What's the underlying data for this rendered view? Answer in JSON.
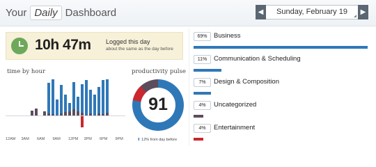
{
  "header": {
    "title_prefix": "Your",
    "period": "Daily",
    "title_suffix": "Dashboard",
    "date": "Sunday, February 19",
    "prev_icon": "triangle-left",
    "next_icon": "triangle-right"
  },
  "logged": {
    "icon": "clock-icon",
    "total": "10h 47m",
    "label": "Logged this day",
    "comparison": "about the same as the day before"
  },
  "hour_chart": {
    "label": "time by hour",
    "ticks": [
      "12AM",
      "3AM",
      "6AM",
      "9AM",
      "12PM",
      "3PM",
      "6PM",
      "9PM"
    ]
  },
  "pulse": {
    "label": "productivity pulse",
    "score": "91",
    "change": "12% from day before",
    "change_icon": "up-arrow"
  },
  "categories": [
    {
      "pct": "69%",
      "name": "Business",
      "value": 69,
      "color": "#2f78b8"
    },
    {
      "pct": "11%",
      "name": "Communication & Scheduling",
      "value": 11,
      "color": "#2f78b8"
    },
    {
      "pct": "7%",
      "name": "Design & Composition",
      "value": 7,
      "color": "#2f78b8"
    },
    {
      "pct": "4%",
      "name": "Uncategorized",
      "value": 4,
      "color": "#5c4d5e"
    },
    {
      "pct": "4%",
      "name": "Entertainment",
      "value": 4,
      "color": "#c8282e"
    }
  ],
  "colors": {
    "very_productive": "#2f78b8",
    "neutral": "#5c4d5e",
    "distracting": "#c8282e",
    "logged_bg": "#f6f1d8",
    "clock": "#6ea85b"
  }
}
